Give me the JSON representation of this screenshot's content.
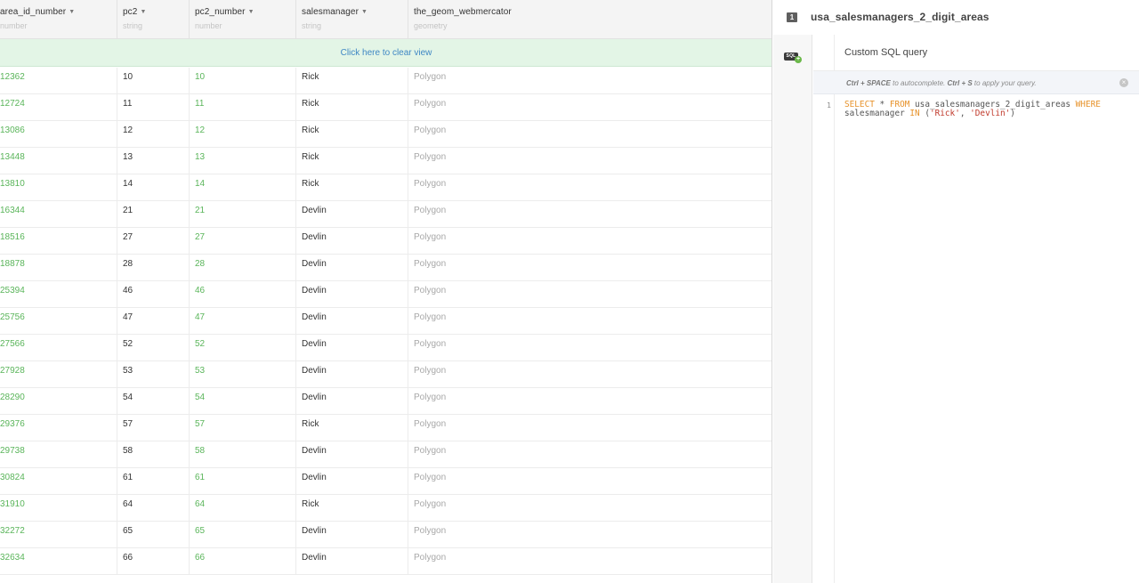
{
  "table": {
    "columns": [
      {
        "name": "area_id_number",
        "type": "number"
      },
      {
        "name": "pc2",
        "type": "string"
      },
      {
        "name": "pc2_number",
        "type": "number"
      },
      {
        "name": "salesmanager",
        "type": "string"
      },
      {
        "name": "the_geom_webmercator",
        "type": "geometry"
      }
    ],
    "clear_view_label": "Click here to clear view",
    "rows": [
      [
        "12362",
        "10",
        "10",
        "Rick",
        "Polygon"
      ],
      [
        "12724",
        "11",
        "11",
        "Rick",
        "Polygon"
      ],
      [
        "13086",
        "12",
        "12",
        "Rick",
        "Polygon"
      ],
      [
        "13448",
        "13",
        "13",
        "Rick",
        "Polygon"
      ],
      [
        "13810",
        "14",
        "14",
        "Rick",
        "Polygon"
      ],
      [
        "16344",
        "21",
        "21",
        "Devlin",
        "Polygon"
      ],
      [
        "18516",
        "27",
        "27",
        "Devlin",
        "Polygon"
      ],
      [
        "18878",
        "28",
        "28",
        "Devlin",
        "Polygon"
      ],
      [
        "25394",
        "46",
        "46",
        "Devlin",
        "Polygon"
      ],
      [
        "25756",
        "47",
        "47",
        "Devlin",
        "Polygon"
      ],
      [
        "27566",
        "52",
        "52",
        "Devlin",
        "Polygon"
      ],
      [
        "27928",
        "53",
        "53",
        "Devlin",
        "Polygon"
      ],
      [
        "28290",
        "54",
        "54",
        "Devlin",
        "Polygon"
      ],
      [
        "29376",
        "57",
        "57",
        "Rick",
        "Polygon"
      ],
      [
        "29738",
        "58",
        "58",
        "Devlin",
        "Polygon"
      ],
      [
        "30824",
        "61",
        "61",
        "Devlin",
        "Polygon"
      ],
      [
        "31910",
        "64",
        "64",
        "Rick",
        "Polygon"
      ],
      [
        "32272",
        "65",
        "65",
        "Devlin",
        "Polygon"
      ],
      [
        "32634",
        "66",
        "66",
        "Devlin",
        "Polygon"
      ]
    ]
  },
  "panel": {
    "layer_number": "1",
    "title": "usa_salesmanagers_2_digit_areas",
    "sql_tool_label": "SQL",
    "editor_title": "Custom SQL query",
    "hint": {
      "shortcut1": "Ctrl + SPACE",
      "text1": " to autocomplete. ",
      "shortcut2": "Ctrl + S",
      "text2": " to apply your query."
    },
    "line_number": "1",
    "sql": {
      "kw_select": "SELECT",
      "star": " * ",
      "kw_from": "FROM",
      "table": " usa_salesmanagers_2_digit_areas ",
      "kw_where": "WHERE",
      "column": "salesmanager ",
      "kw_in": "IN",
      "open": " (",
      "val1": "'Rick'",
      "comma": ", ",
      "val2": "'Devlin'",
      "close": ")"
    }
  },
  "colors": {
    "number_green": "#5ab55a",
    "link_blue": "#3f87c4",
    "clear_view_bg": "#e3f5e6",
    "sql_keyword": "#e7922a",
    "sql_string": "#c0392b"
  }
}
